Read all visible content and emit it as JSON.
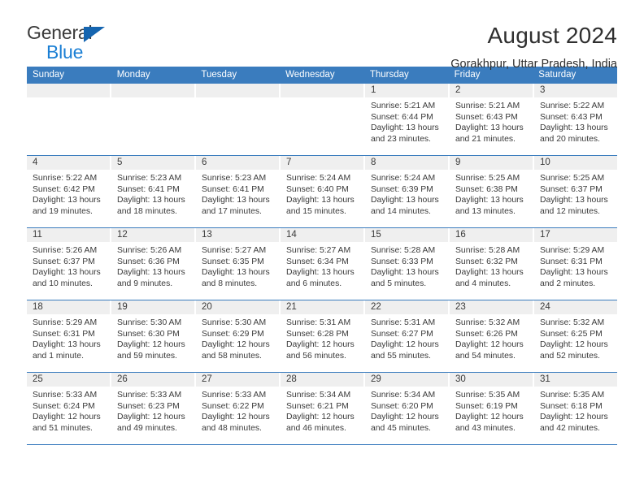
{
  "brand": {
    "name_part1": "General",
    "name_part2": "Blue",
    "accent_color": "#1b7fd4",
    "triangle_color": "#1565b0"
  },
  "header": {
    "title": "August 2024",
    "subtitle": "Gorakhpur, Uttar Pradesh, India"
  },
  "calendar": {
    "header_color": "#3a7cbe",
    "daynum_band_color": "#efefef",
    "weekdays": [
      "Sunday",
      "Monday",
      "Tuesday",
      "Wednesday",
      "Thursday",
      "Friday",
      "Saturday"
    ],
    "weeks": [
      [
        {
          "day": "",
          "lines": []
        },
        {
          "day": "",
          "lines": []
        },
        {
          "day": "",
          "lines": []
        },
        {
          "day": "",
          "lines": []
        },
        {
          "day": "1",
          "lines": [
            "Sunrise: 5:21 AM",
            "Sunset: 6:44 PM",
            "Daylight: 13 hours",
            "and 23 minutes."
          ]
        },
        {
          "day": "2",
          "lines": [
            "Sunrise: 5:21 AM",
            "Sunset: 6:43 PM",
            "Daylight: 13 hours",
            "and 21 minutes."
          ]
        },
        {
          "day": "3",
          "lines": [
            "Sunrise: 5:22 AM",
            "Sunset: 6:43 PM",
            "Daylight: 13 hours",
            "and 20 minutes."
          ]
        }
      ],
      [
        {
          "day": "4",
          "lines": [
            "Sunrise: 5:22 AM",
            "Sunset: 6:42 PM",
            "Daylight: 13 hours",
            "and 19 minutes."
          ]
        },
        {
          "day": "5",
          "lines": [
            "Sunrise: 5:23 AM",
            "Sunset: 6:41 PM",
            "Daylight: 13 hours",
            "and 18 minutes."
          ]
        },
        {
          "day": "6",
          "lines": [
            "Sunrise: 5:23 AM",
            "Sunset: 6:41 PM",
            "Daylight: 13 hours",
            "and 17 minutes."
          ]
        },
        {
          "day": "7",
          "lines": [
            "Sunrise: 5:24 AM",
            "Sunset: 6:40 PM",
            "Daylight: 13 hours",
            "and 15 minutes."
          ]
        },
        {
          "day": "8",
          "lines": [
            "Sunrise: 5:24 AM",
            "Sunset: 6:39 PM",
            "Daylight: 13 hours",
            "and 14 minutes."
          ]
        },
        {
          "day": "9",
          "lines": [
            "Sunrise: 5:25 AM",
            "Sunset: 6:38 PM",
            "Daylight: 13 hours",
            "and 13 minutes."
          ]
        },
        {
          "day": "10",
          "lines": [
            "Sunrise: 5:25 AM",
            "Sunset: 6:37 PM",
            "Daylight: 13 hours",
            "and 12 minutes."
          ]
        }
      ],
      [
        {
          "day": "11",
          "lines": [
            "Sunrise: 5:26 AM",
            "Sunset: 6:37 PM",
            "Daylight: 13 hours",
            "and 10 minutes."
          ]
        },
        {
          "day": "12",
          "lines": [
            "Sunrise: 5:26 AM",
            "Sunset: 6:36 PM",
            "Daylight: 13 hours",
            "and 9 minutes."
          ]
        },
        {
          "day": "13",
          "lines": [
            "Sunrise: 5:27 AM",
            "Sunset: 6:35 PM",
            "Daylight: 13 hours",
            "and 8 minutes."
          ]
        },
        {
          "day": "14",
          "lines": [
            "Sunrise: 5:27 AM",
            "Sunset: 6:34 PM",
            "Daylight: 13 hours",
            "and 6 minutes."
          ]
        },
        {
          "day": "15",
          "lines": [
            "Sunrise: 5:28 AM",
            "Sunset: 6:33 PM",
            "Daylight: 13 hours",
            "and 5 minutes."
          ]
        },
        {
          "day": "16",
          "lines": [
            "Sunrise: 5:28 AM",
            "Sunset: 6:32 PM",
            "Daylight: 13 hours",
            "and 4 minutes."
          ]
        },
        {
          "day": "17",
          "lines": [
            "Sunrise: 5:29 AM",
            "Sunset: 6:31 PM",
            "Daylight: 13 hours",
            "and 2 minutes."
          ]
        }
      ],
      [
        {
          "day": "18",
          "lines": [
            "Sunrise: 5:29 AM",
            "Sunset: 6:31 PM",
            "Daylight: 13 hours",
            "and 1 minute."
          ]
        },
        {
          "day": "19",
          "lines": [
            "Sunrise: 5:30 AM",
            "Sunset: 6:30 PM",
            "Daylight: 12 hours",
            "and 59 minutes."
          ]
        },
        {
          "day": "20",
          "lines": [
            "Sunrise: 5:30 AM",
            "Sunset: 6:29 PM",
            "Daylight: 12 hours",
            "and 58 minutes."
          ]
        },
        {
          "day": "21",
          "lines": [
            "Sunrise: 5:31 AM",
            "Sunset: 6:28 PM",
            "Daylight: 12 hours",
            "and 56 minutes."
          ]
        },
        {
          "day": "22",
          "lines": [
            "Sunrise: 5:31 AM",
            "Sunset: 6:27 PM",
            "Daylight: 12 hours",
            "and 55 minutes."
          ]
        },
        {
          "day": "23",
          "lines": [
            "Sunrise: 5:32 AM",
            "Sunset: 6:26 PM",
            "Daylight: 12 hours",
            "and 54 minutes."
          ]
        },
        {
          "day": "24",
          "lines": [
            "Sunrise: 5:32 AM",
            "Sunset: 6:25 PM",
            "Daylight: 12 hours",
            "and 52 minutes."
          ]
        }
      ],
      [
        {
          "day": "25",
          "lines": [
            "Sunrise: 5:33 AM",
            "Sunset: 6:24 PM",
            "Daylight: 12 hours",
            "and 51 minutes."
          ]
        },
        {
          "day": "26",
          "lines": [
            "Sunrise: 5:33 AM",
            "Sunset: 6:23 PM",
            "Daylight: 12 hours",
            "and 49 minutes."
          ]
        },
        {
          "day": "27",
          "lines": [
            "Sunrise: 5:33 AM",
            "Sunset: 6:22 PM",
            "Daylight: 12 hours",
            "and 48 minutes."
          ]
        },
        {
          "day": "28",
          "lines": [
            "Sunrise: 5:34 AM",
            "Sunset: 6:21 PM",
            "Daylight: 12 hours",
            "and 46 minutes."
          ]
        },
        {
          "day": "29",
          "lines": [
            "Sunrise: 5:34 AM",
            "Sunset: 6:20 PM",
            "Daylight: 12 hours",
            "and 45 minutes."
          ]
        },
        {
          "day": "30",
          "lines": [
            "Sunrise: 5:35 AM",
            "Sunset: 6:19 PM",
            "Daylight: 12 hours",
            "and 43 minutes."
          ]
        },
        {
          "day": "31",
          "lines": [
            "Sunrise: 5:35 AM",
            "Sunset: 6:18 PM",
            "Daylight: 12 hours",
            "and 42 minutes."
          ]
        }
      ]
    ]
  }
}
